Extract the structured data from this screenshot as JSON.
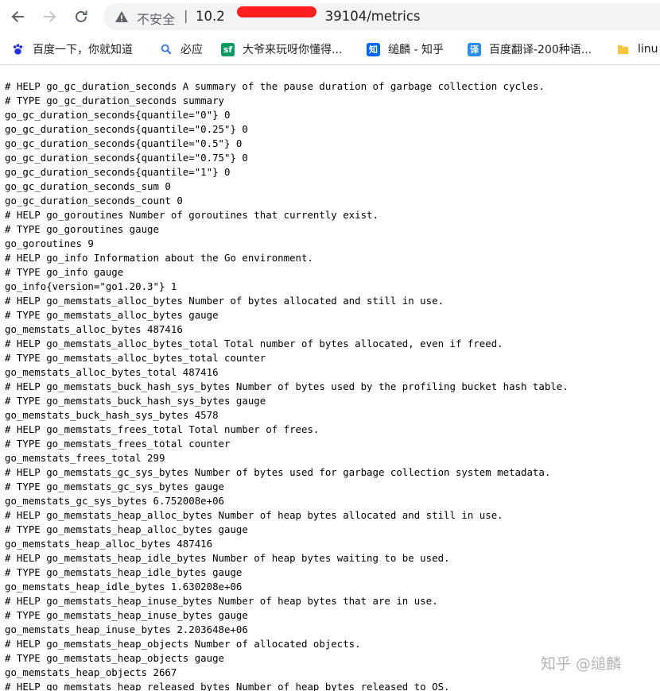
{
  "browser": {
    "insecure_label": "不安全",
    "separator": "|",
    "url_host": "10.2",
    "url_port_path": "39104/metrics",
    "back_label": "back",
    "forward_label": "forward",
    "reload_label": "reload"
  },
  "bookmarks": [
    {
      "label": "百度一下，你就知道",
      "icon": "paw-icon",
      "color": "#2932e1"
    },
    {
      "label": "必应",
      "icon": "search-icon",
      "color": "#3c78d8"
    },
    {
      "label": "大爷来玩呀你懂得...",
      "icon": "sf-icon",
      "glyph": "sf",
      "color": "#009a61"
    },
    {
      "label": "缒麟 - 知乎",
      "icon": "zhihu-icon",
      "glyph": "知",
      "color": "#0066ff"
    },
    {
      "label": "百度翻译-200种语...",
      "icon": "translate-icon",
      "glyph": "译",
      "color": "#2a8cf0"
    },
    {
      "label": "linu",
      "icon": "folder-icon",
      "color": "#f5c542"
    }
  ],
  "metrics_lines": [
    "# HELP go_gc_duration_seconds A summary of the pause duration of garbage collection cycles.",
    "# TYPE go_gc_duration_seconds summary",
    "go_gc_duration_seconds{quantile=\"0\"} 0",
    "go_gc_duration_seconds{quantile=\"0.25\"} 0",
    "go_gc_duration_seconds{quantile=\"0.5\"} 0",
    "go_gc_duration_seconds{quantile=\"0.75\"} 0",
    "go_gc_duration_seconds{quantile=\"1\"} 0",
    "go_gc_duration_seconds_sum 0",
    "go_gc_duration_seconds_count 0",
    "# HELP go_goroutines Number of goroutines that currently exist.",
    "# TYPE go_goroutines gauge",
    "go_goroutines 9",
    "# HELP go_info Information about the Go environment.",
    "# TYPE go_info gauge",
    "go_info{version=\"go1.20.3\"} 1",
    "# HELP go_memstats_alloc_bytes Number of bytes allocated and still in use.",
    "# TYPE go_memstats_alloc_bytes gauge",
    "go_memstats_alloc_bytes 487416",
    "# HELP go_memstats_alloc_bytes_total Total number of bytes allocated, even if freed.",
    "# TYPE go_memstats_alloc_bytes_total counter",
    "go_memstats_alloc_bytes_total 487416",
    "# HELP go_memstats_buck_hash_sys_bytes Number of bytes used by the profiling bucket hash table.",
    "# TYPE go_memstats_buck_hash_sys_bytes gauge",
    "go_memstats_buck_hash_sys_bytes 4578",
    "# HELP go_memstats_frees_total Total number of frees.",
    "# TYPE go_memstats_frees_total counter",
    "go_memstats_frees_total 299",
    "# HELP go_memstats_gc_sys_bytes Number of bytes used for garbage collection system metadata.",
    "# TYPE go_memstats_gc_sys_bytes gauge",
    "go_memstats_gc_sys_bytes 6.752008e+06",
    "# HELP go_memstats_heap_alloc_bytes Number of heap bytes allocated and still in use.",
    "# TYPE go_memstats_heap_alloc_bytes gauge",
    "go_memstats_heap_alloc_bytes 487416",
    "# HELP go_memstats_heap_idle_bytes Number of heap bytes waiting to be used.",
    "# TYPE go_memstats_heap_idle_bytes gauge",
    "go_memstats_heap_idle_bytes 1.630208e+06",
    "# HELP go_memstats_heap_inuse_bytes Number of heap bytes that are in use.",
    "# TYPE go_memstats_heap_inuse_bytes gauge",
    "go_memstats_heap_inuse_bytes 2.203648e+06",
    "# HELP go_memstats_heap_objects Number of allocated objects.",
    "# TYPE go_memstats_heap_objects gauge",
    "go_memstats_heap_objects 2667",
    "# HELP go_memstats_heap_released_bytes Number of heap bytes released to OS."
  ],
  "watermark": "知乎 @缒麟",
  "colors": {
    "redaction": "#ff1f1f",
    "omnibox": "#f1f3f4"
  }
}
